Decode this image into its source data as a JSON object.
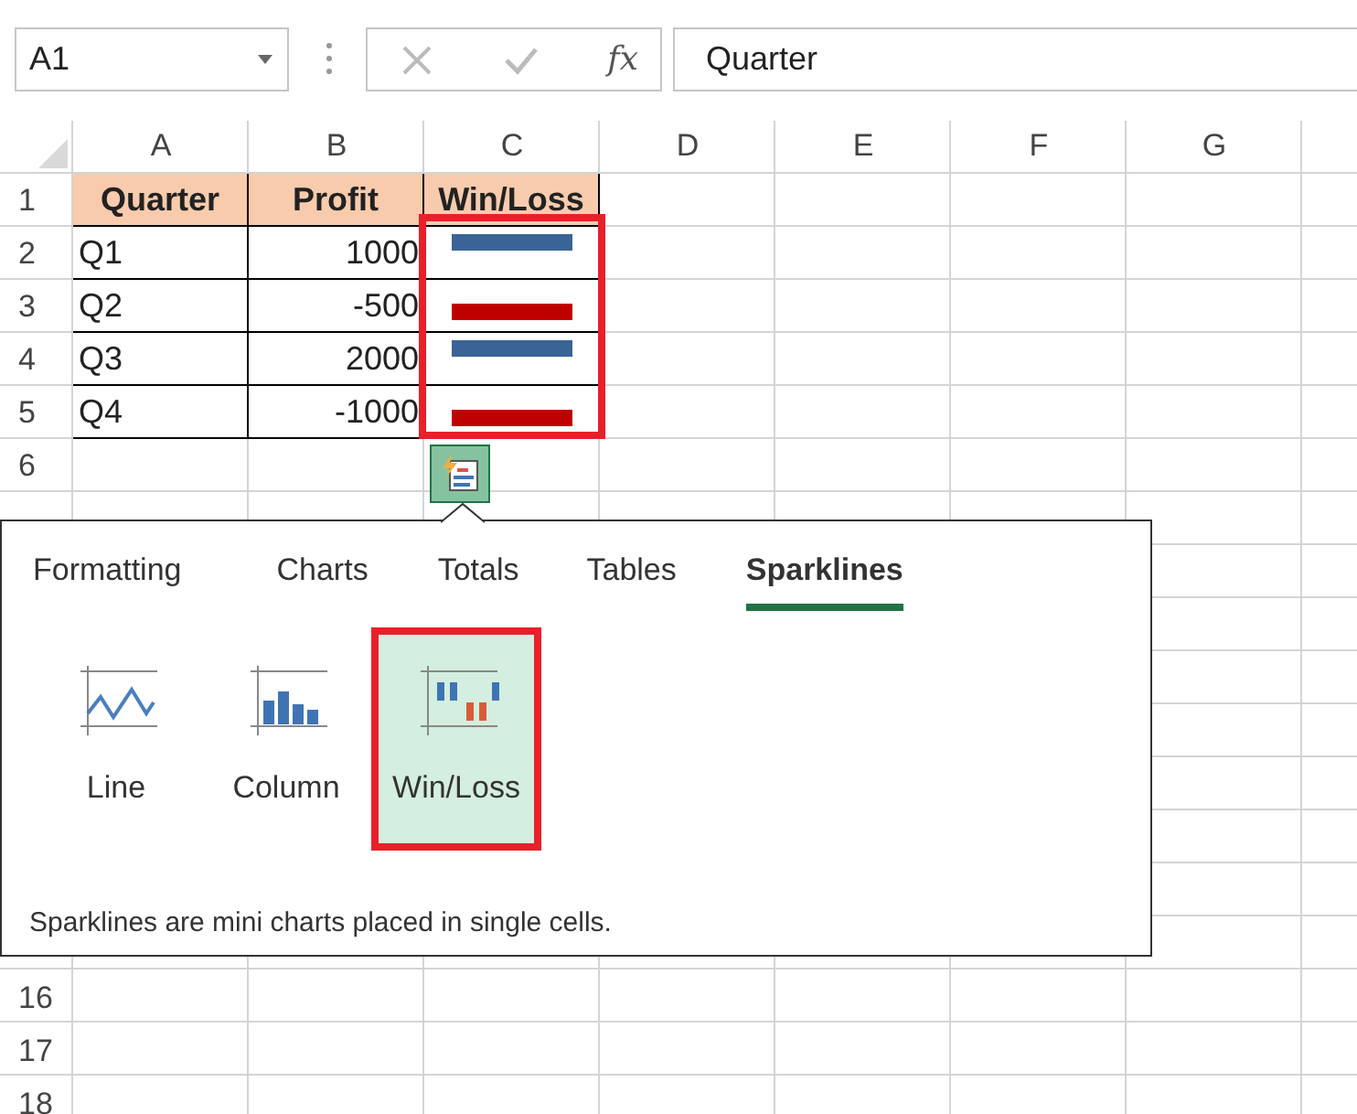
{
  "name_box": {
    "value": "A1"
  },
  "formula_bar": {
    "fx": "fx",
    "value": "Quarter"
  },
  "columns": [
    "A",
    "B",
    "C",
    "D",
    "E",
    "F",
    "G"
  ],
  "rows_top": [
    {
      "number": "1",
      "cells": [
        {
          "kind": "header",
          "text": "Quarter"
        },
        {
          "kind": "header",
          "text": "Profit"
        },
        {
          "kind": "header",
          "text": "Win/Loss"
        }
      ]
    },
    {
      "number": "2",
      "cells": [
        {
          "kind": "text",
          "text": "Q1"
        },
        {
          "kind": "number",
          "text": "1000"
        },
        {
          "kind": "sparkline",
          "win": true
        }
      ]
    },
    {
      "number": "3",
      "cells": [
        {
          "kind": "text",
          "text": "Q2"
        },
        {
          "kind": "number",
          "text": "-500"
        },
        {
          "kind": "sparkline",
          "win": false
        }
      ]
    },
    {
      "number": "4",
      "cells": [
        {
          "kind": "text",
          "text": "Q3"
        },
        {
          "kind": "number",
          "text": "2000"
        },
        {
          "kind": "sparkline",
          "win": true
        }
      ]
    },
    {
      "number": "5",
      "cells": [
        {
          "kind": "text",
          "text": "Q4"
        },
        {
          "kind": "number",
          "text": "-1000"
        },
        {
          "kind": "sparkline",
          "win": false
        }
      ]
    },
    {
      "number": "6"
    }
  ],
  "rows_bottom": [
    {
      "number": "16"
    },
    {
      "number": "17"
    },
    {
      "number": "18"
    }
  ],
  "quick_analysis": {
    "tabs": [
      {
        "label": "Formatting",
        "selected": false
      },
      {
        "label": "Charts",
        "selected": false
      },
      {
        "label": "Totals",
        "selected": false
      },
      {
        "label": "Tables",
        "selected": false
      },
      {
        "label": "Sparklines",
        "selected": true
      }
    ],
    "options": [
      {
        "kind": "line",
        "label": "Line",
        "selected": false
      },
      {
        "kind": "column",
        "label": "Column",
        "selected": false
      },
      {
        "kind": "winloss",
        "label": "Win/Loss",
        "selected": true
      }
    ],
    "description": "Sparklines are mini charts placed in single cells."
  }
}
